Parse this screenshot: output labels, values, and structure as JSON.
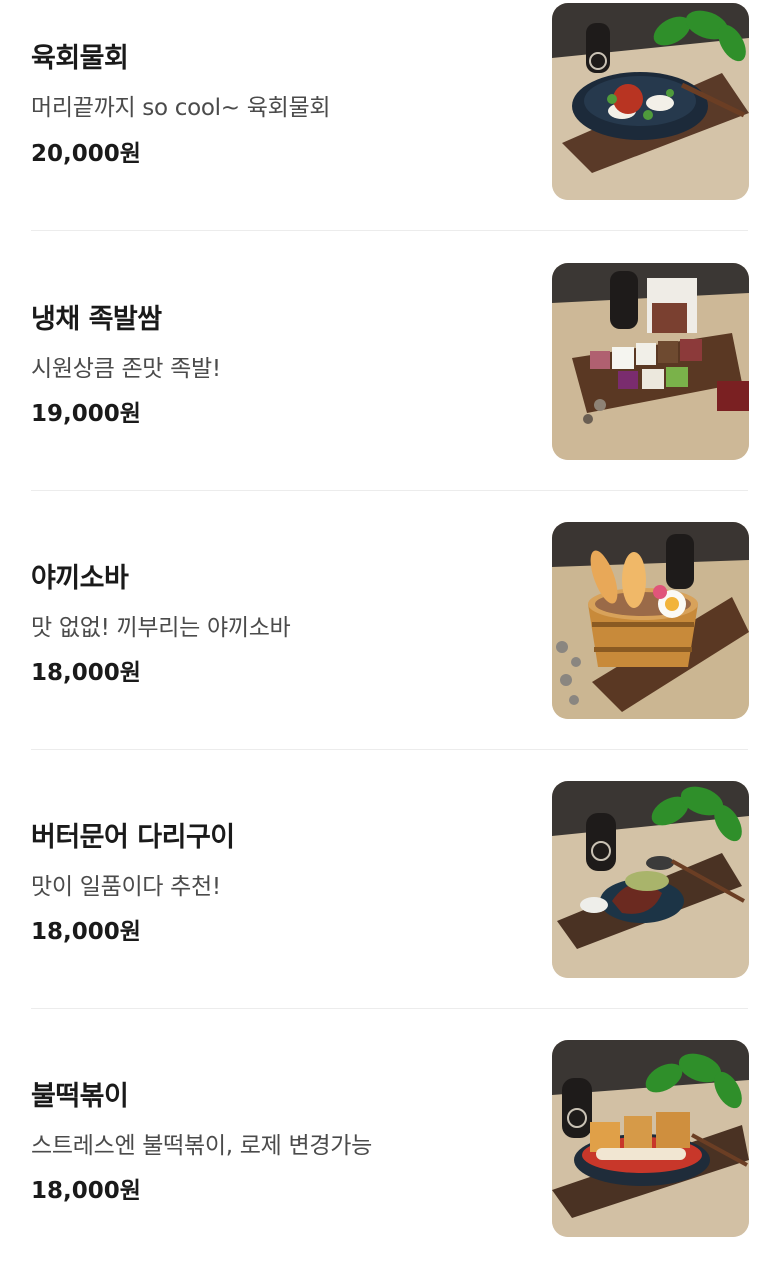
{
  "menu": {
    "items": [
      {
        "name": "육회물회",
        "description": "머리끝까지 so cool~ 육회물회",
        "price": "20,000원",
        "image": "yukhoe-mulhoe-photo",
        "leaves": true,
        "dish": "bowl"
      },
      {
        "name": "냉채 족발쌈",
        "description": "시원상큼 존맛 족발!",
        "price": "19,000원",
        "image": "jokbal-platter-photo",
        "leaves": false,
        "dish": "platter"
      },
      {
        "name": "야끼소바",
        "description": "맛 없없! 끼부리는 야끼소바",
        "price": "18,000원",
        "image": "yakisoba-bucket-photo",
        "leaves": false,
        "dish": "bucket"
      },
      {
        "name": "버터문어 다리구이",
        "description": "맛이 일품이다 추천!",
        "price": "18,000원",
        "image": "butter-octopus-photo",
        "leaves": true,
        "dish": "octopus"
      },
      {
        "name": "불떡볶이",
        "description": "스트레스엔 불떡볶이, 로제 변경가능",
        "price": "18,000원",
        "image": "tteokbokki-pan-photo",
        "leaves": true,
        "dish": "pan"
      }
    ]
  }
}
